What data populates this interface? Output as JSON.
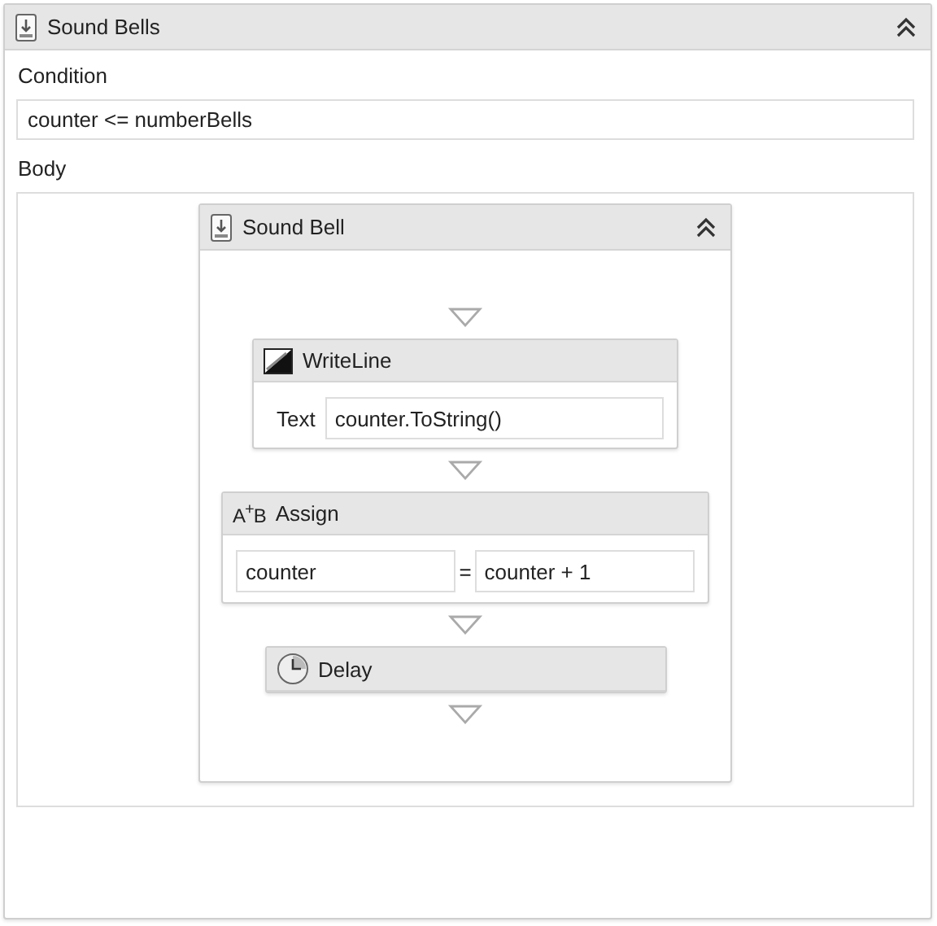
{
  "while": {
    "title": "Sound Bells",
    "expanded": true,
    "condition": {
      "label": "Condition",
      "value": "counter <= numberBells"
    },
    "body": {
      "label": "Body",
      "sequence": {
        "title": "Sound Bell",
        "expanded": true,
        "activities": [
          {
            "kind": "writeline",
            "title": "WriteLine",
            "field_label": "Text",
            "value": "counter.ToString()"
          },
          {
            "kind": "assign",
            "title": "Assign",
            "icon_text": "A$^{+}$B",
            "to": "counter",
            "operator": "=",
            "value": "counter + 1"
          },
          {
            "kind": "delay",
            "title": "Delay"
          }
        ]
      }
    }
  }
}
